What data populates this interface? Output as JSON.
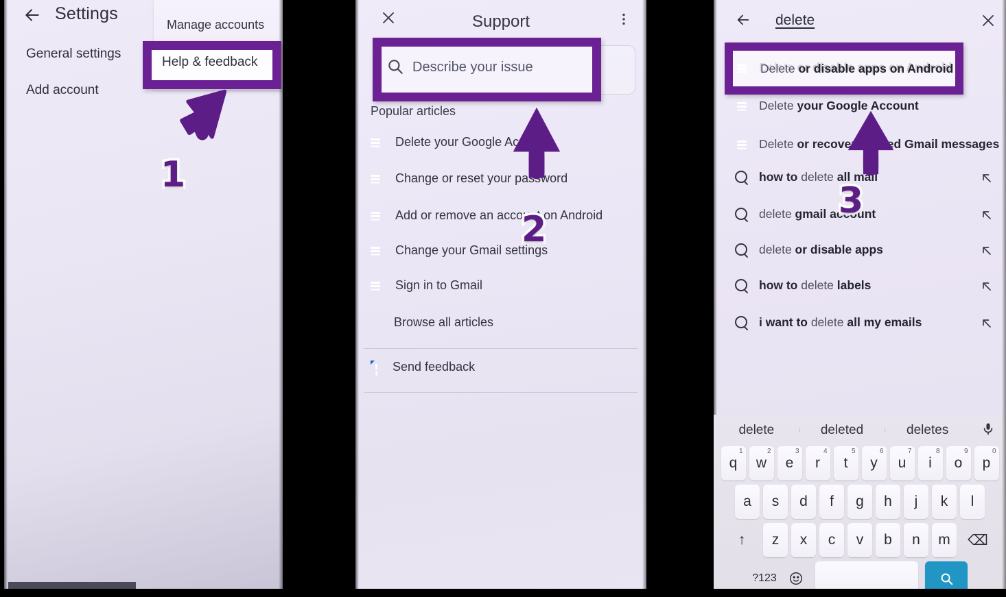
{
  "colors": {
    "highlight_purple": "#6b2193",
    "arrow_purple": "#5c1d86",
    "article_icon_blue": "#1565c0",
    "enter_key_blue": "#2196c4",
    "panel_background": "#eae6f4",
    "text_primary": "#2f2f3b"
  },
  "steps": {
    "one": "1",
    "two": "2",
    "three": "3"
  },
  "panel1": {
    "appbar": {
      "back_icon": "arrow-left-icon",
      "title": "Settings"
    },
    "items": [
      {
        "label": "General settings"
      },
      {
        "label": "Add account"
      }
    ],
    "card": {
      "manage_label": "Manage accounts",
      "help_label": "Help & feedback"
    }
  },
  "panel2": {
    "appbar": {
      "close_icon": "close-icon",
      "title": "Support",
      "overflow_icon": "more-vertical-icon"
    },
    "search": {
      "icon": "search-icon",
      "placeholder": "Describe your issue",
      "value": ""
    },
    "section_title": "Popular articles",
    "articles": [
      {
        "icon": "article-icon",
        "label": "Delete your Google Account"
      },
      {
        "icon": "article-icon",
        "label": "Change or reset your password"
      },
      {
        "icon": "article-icon",
        "label": "Add or remove an account on Android"
      },
      {
        "icon": "article-icon",
        "label": "Change your Gmail settings"
      },
      {
        "icon": "article-icon",
        "label": "Sign in to Gmail"
      }
    ],
    "browse_all": "Browse all articles",
    "send_feedback": {
      "icon": "feedback-icon",
      "label": "Send feedback"
    }
  },
  "panel3": {
    "appbar": {
      "back_icon": "arrow-left-icon",
      "query": "delete",
      "close_icon": "close-icon"
    },
    "article_results": [
      {
        "icon": "article-icon",
        "match": "Delete",
        "rest": " or disable apps on Android"
      },
      {
        "icon": "article-icon",
        "match": "Delete",
        "rest": " your Google Account"
      },
      {
        "icon": "article-icon",
        "match": "Delete",
        "rest": " or recover deleted Gmail messages"
      }
    ],
    "suggestions": [
      {
        "icon": "search-icon",
        "pre": "how to ",
        "match": "delete",
        "post": " all mail",
        "fill_icon": "arrow-up-left-icon"
      },
      {
        "icon": "search-icon",
        "pre": "",
        "match": "delete",
        "post": " gmail account",
        "fill_icon": "arrow-up-left-icon"
      },
      {
        "icon": "search-icon",
        "pre": "",
        "match": "delete",
        "post": " or disable apps",
        "fill_icon": "arrow-up-left-icon"
      },
      {
        "icon": "search-icon",
        "pre": "how to ",
        "match": "delete",
        "post": " labels",
        "fill_icon": "arrow-up-left-icon"
      },
      {
        "icon": "search-icon",
        "pre": "i want to ",
        "match": "delete",
        "post": " all my emails",
        "fill_icon": "arrow-up-left-icon"
      }
    ],
    "keyboard": {
      "suggestions": [
        "delete",
        "deleted",
        "deletes"
      ],
      "mic_icon": "microphone-icon",
      "row1": [
        {
          "key": "q",
          "num": "1"
        },
        {
          "key": "w",
          "num": "2"
        },
        {
          "key": "e",
          "num": "3"
        },
        {
          "key": "r",
          "num": "4"
        },
        {
          "key": "t",
          "num": "5"
        },
        {
          "key": "y",
          "num": "6"
        },
        {
          "key": "u",
          "num": "7"
        },
        {
          "key": "i",
          "num": "8"
        },
        {
          "key": "o",
          "num": "9"
        },
        {
          "key": "p",
          "num": "0"
        }
      ],
      "row2": [
        {
          "key": "a"
        },
        {
          "key": "s"
        },
        {
          "key": "d"
        },
        {
          "key": "f"
        },
        {
          "key": "g"
        },
        {
          "key": "h"
        },
        {
          "key": "j"
        },
        {
          "key": "k"
        },
        {
          "key": "l"
        }
      ],
      "row3": [
        {
          "key": "↑",
          "name": "shift-key"
        },
        {
          "key": "z"
        },
        {
          "key": "x"
        },
        {
          "key": "c"
        },
        {
          "key": "v"
        },
        {
          "key": "b"
        },
        {
          "key": "n"
        },
        {
          "key": "m"
        },
        {
          "key": "⌫",
          "name": "backspace-key"
        }
      ],
      "row4": {
        "symbols": "?123",
        "emoji_icon": "emoji-icon",
        "space": "",
        "enter_icon": "search-icon"
      }
    }
  }
}
